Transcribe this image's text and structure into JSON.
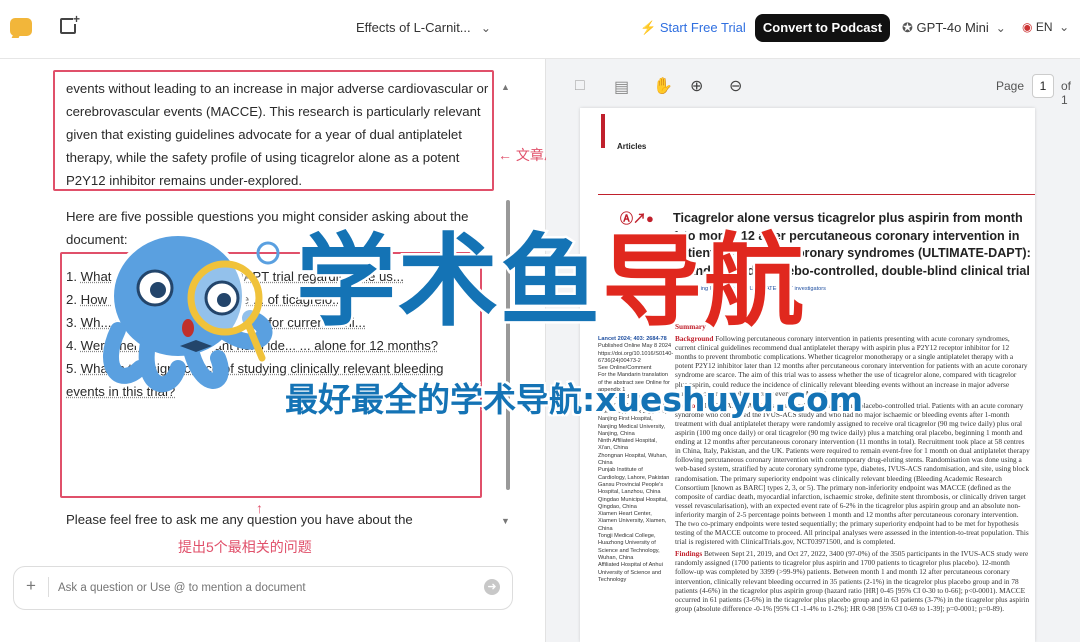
{
  "header": {
    "doc_title": "Effects of L-Carnit...",
    "start_trial": "Start Free Trial",
    "convert": "Convert to Podcast",
    "model": "GPT-4o Mini",
    "lang": "EN"
  },
  "chat": {
    "summary": "events without leading to an increase in major adverse cardiovascular or cerebrovascular events (MACCE). This research is particularly relevant given that existing guidelines advocate for a year of dual antiplatelet therapy, while the safety profile of using ticagrelor alone as a potent P2Y12 inhibitor remains under-explored.",
    "summary_annotation": "← 文章总结",
    "intro": "Here are five possible questions you might consider asking about the document:",
    "questions": [
      {
        "num": "1.",
        "text": "What ... of the ULTIMATE-DAPT trial regarding the us..."
      },
      {
        "num": "2.",
        "text": "How do ... ticagrelor ... to the ... of ticagrelo..."
      },
      {
        "num": "3.",
        "text": "Wh... the ULTIMATE-DAPT trial for current clini..."
      },
      {
        "num": "4.",
        "text": "Were there any significant risks ide... ... alone for 12 months?"
      },
      {
        "num": "5.",
        "text": "What is the significance of studying clinically relevant bleeding events in this trial?"
      }
    ],
    "closing": "Please feel free to ask me any question you have about the",
    "questions_annotation": "提出5个最相关的问题",
    "input_placeholder": "Ask a question or Use @ to mention a document"
  },
  "pdf": {
    "page_label": "Page",
    "page_num": "1",
    "page_of": "of 1",
    "section": "Articles",
    "title": "Ticagrelor alone versus ticagrelor plus aspirin from month 1 to month 12 after percutaneous coronary intervention in patients with acute coronary syndromes (ULTIMATE-DAPT): a randomised, placebo-controlled, double-blind clinical trial",
    "authors": "Zhen Ge, Jing Kan, ... , for the ULTIMATE-DAPT investigators",
    "summary_head": "Summary",
    "background_head": "Background",
    "background": "Following percutaneous coronary intervention in patients presenting with acute coronary syndromes, current clinical guidelines recommend dual antiplatelet therapy with aspirin plus a P2Y12 receptor inhibitor for 12 months to prevent thrombotic complications. Whether ticagrelor monotherapy or a single antiplatelet therapy with a potent P2Y12 inhibitor later than 12 months after percutaneous coronary intervention for patients with an acute coronary syndrome are scarce. The aim of this trial was to assess whether the use of ticagrelor alone, compared with ticagrelor plus aspirin, could reduce the incidence of clinically relevant bleeding events without an increase in major adverse cardiovascular or cerebrovascular events (MACCE).",
    "methods_head": "Methods",
    "methods": "ULTIMATE-DAPT was a randomised, double-blind, placebo-controlled trial. Patients with an acute coronary syndrome who completed the IVUS-ACS study and who had no major ischaemic or bleeding events after 1-month treatment with dual antiplatelet therapy were randomly assigned to receive oral ticagrelor (90 mg twice daily) plus oral aspirin (100 mg once daily) or oral ticagrelor (90 mg twice daily) plus a matching oral placebo, beginning 1 month and ending at 12 months after percutaneous coronary intervention (11 months in total). Recruitment took place at 58 centres in China, Italy, Pakistan, and the UK. Patients were required to remain event-free for 1 month on dual antiplatelet therapy following percutaneous coronary intervention with contemporary drug-eluting stents. Randomisation was done using a web-based system, stratified by acute coronary syndrome type, diabetes, IVUS-ACS randomisation, and site, using block randomisation. The primary superiority endpoint was clinically relevant bleeding (Bleeding Academic Research Consortium [known as BARC] types 2, 3, or 5). The primary non-inferiority endpoint was MACCE (defined as the composite of cardiac death, myocardial infarction, ischaemic stroke, definite stent thrombosis, or clinically driven target vessel revascularisation), with an expected event rate of 6-2% in the ticagrelor plus aspirin group and an absolute non-inferiority margin of 2-5 percentage points between 1 month and 12 months after percutaneous coronary intervention. The two co-primary endpoints were tested sequentially; the primary superiority endpoint had to be met for hypothesis testing of the MACCE outcome to proceed. All principal analyses were assessed in the intention-to-treat population. This trial is registered with ClinicalTrials.gov, NCT03971500, and is completed.",
    "findings_head": "Findings",
    "findings": "Between Sept 21, 2019, and Oct 27, 2022, 3400 (97-0%) of the 3505 participants in the IVUS-ACS study were randomly assigned (1700 patients to ticagrelor plus aspirin and 1700 patients to ticagrelor plus placebo). 12-month follow-up was completed by 3399 (>99-9%) patients. Between month 1 and month 12 after percutaneous coronary intervention, clinically relevant bleeding occurred in 35 patients (2-1%) in the ticagrelor plus placebo group and in 78 patients (4-6%) in the ticagrelor plus aspirin group (hazard ratio [HR] 0-45 [95% CI 0-30 to 0-66]; p<0-0001). MACCE occurred in 61 patients (3-6%) in the ticagrelor plus placebo group and in 63 patients (3-7%) in the ticagrelor plus aspirin group (absolute difference -0-1% [95% CI -1-4% to 1-2%]; HR 0-98 [95% CI 0-69 to 1-39]; p=0-0001; p=0-89).",
    "margin": [
      "Lancet 2024; 403: 2684-78",
      "Published Online May 8 2024",
      "https://doi.org/10.1016/S0140-6736(24)00473-2",
      "See Online/Comment",
      "For the Mandarin translation of the abstract see Online for appendix 1",
      "*Contributed equally",
      "†Study group members are listed in appendix 2 (pp 5-6)",
      "Nanjing First Hospital, Nanjing Medical University, Nanjing, China",
      "Ninth Affiliated Hospital, Xi'an, China",
      "Zhongnan Hospital, Wuhan, China",
      "Punjab Institute of Cardiology, Lahore, Pakistan",
      "Gansu Provincial People's Hospital, Lanzhou, China",
      "Qingdao Municipal Hospital, Qingdao, China",
      "Xiamen Heart Center, Xiamen University, Xiamen, China",
      "Tongji Medical College, Huazhong University of Science and Technology, Wuhan, China",
      "Affiliated Hospital of Anhui University of Science and Technology"
    ]
  },
  "watermark": {
    "title_part1": "学术鱼",
    "title_part2": "导航",
    "subtitle": "最好最全的学术导航:xueshuyu.com",
    "colors": {
      "blue": "#1473b5",
      "red": "#e0281e",
      "octopus": "#5aa0e0"
    }
  }
}
